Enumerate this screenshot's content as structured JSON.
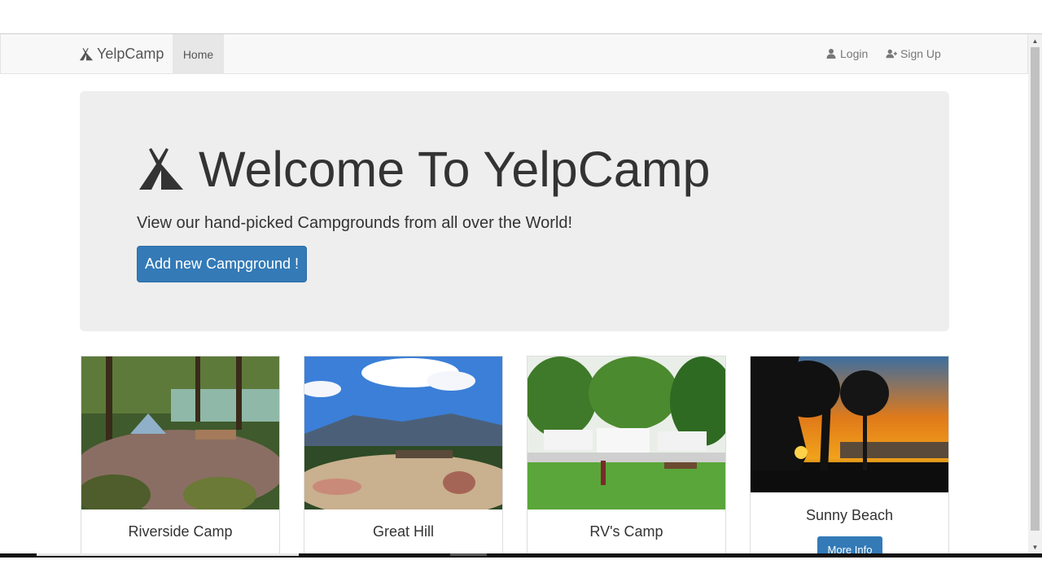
{
  "navbar": {
    "brand": "YelpCamp",
    "home": "Home",
    "login": "Login",
    "signup": "Sign Up"
  },
  "jumbotron": {
    "title": "Welcome To YelpCamp",
    "subtitle": "View our hand-picked Campgrounds from all over the World!",
    "button": "Add new Campground !"
  },
  "campgrounds": [
    {
      "name": "Riverside Camp"
    },
    {
      "name": "Great Hill"
    },
    {
      "name": "RV's Camp"
    },
    {
      "name": "Sunny Beach",
      "button": "More Info"
    }
  ],
  "colors": {
    "primary": "#337ab7",
    "jumbotron_bg": "#eeeeee",
    "navbar_bg": "#f8f8f8"
  },
  "icons": {
    "brand": "tent-icon",
    "login": "user-icon",
    "signup": "user-plus-icon"
  }
}
